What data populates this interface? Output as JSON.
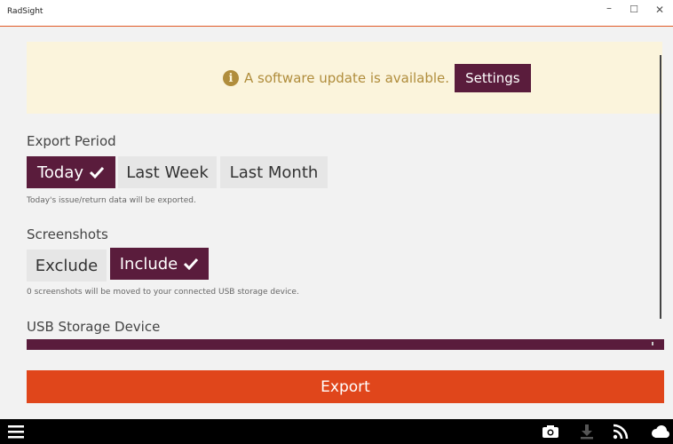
{
  "window": {
    "title": "RadSight",
    "minimize_glyph": "–",
    "maximize_glyph": "☐",
    "close_glyph": "✕"
  },
  "banner": {
    "info_glyph": "i",
    "message": "A software update is available.",
    "settings_label": "Settings"
  },
  "export_period": {
    "label": "Export Period",
    "options": [
      "Today",
      "Last Week",
      "Last Month"
    ],
    "selected": "Today",
    "hint": "Today's issue/return data will be exported."
  },
  "screenshots": {
    "label": "Screenshots",
    "options": [
      "Exclude",
      "Include"
    ],
    "selected": "Include",
    "hint": "0 screenshots will be moved to your connected USB storage device."
  },
  "usb": {
    "label": "USB Storage Device"
  },
  "export_label": "Export",
  "bottom_bar": {
    "icons": [
      "menu-icon",
      "camera-icon",
      "download-icon",
      "rss-icon",
      "cloud-icon"
    ]
  },
  "colors": {
    "accent": "#5a1c3c",
    "export": "#e0461b",
    "banner_bg": "#fbf4dc",
    "banner_text": "#b08d3c"
  }
}
